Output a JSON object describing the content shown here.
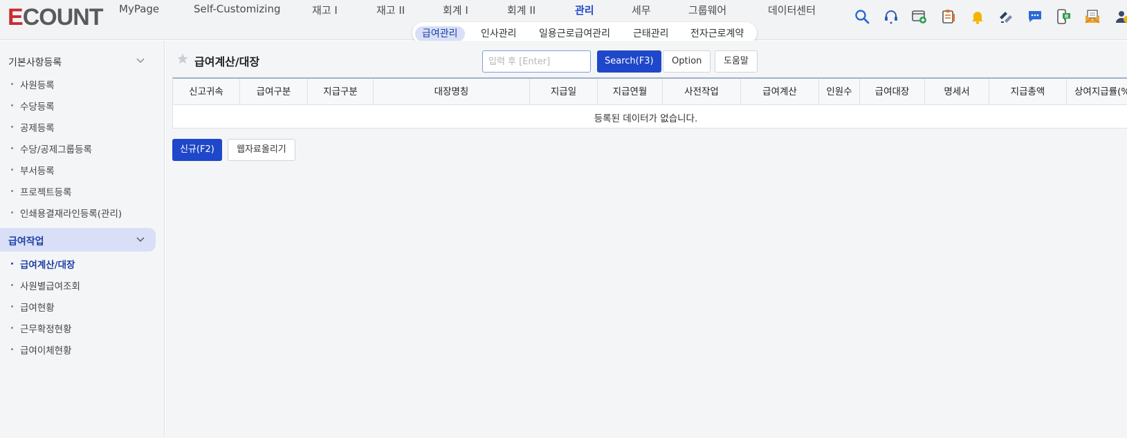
{
  "header": {
    "logo": {
      "first": "E",
      "rest": "COUNT"
    },
    "main_nav": [
      {
        "label": "MyPage",
        "active": false
      },
      {
        "label": "Self-Customizing",
        "active": false
      },
      {
        "label": "재고 I",
        "active": false
      },
      {
        "label": "재고 II",
        "active": false
      },
      {
        "label": "회계 I",
        "active": false
      },
      {
        "label": "회계 II",
        "active": false
      },
      {
        "label": "관리",
        "active": true
      },
      {
        "label": "세무",
        "active": false
      },
      {
        "label": "그룹웨어",
        "active": false
      },
      {
        "label": "데이터센터",
        "active": false
      }
    ],
    "sub_nav": [
      {
        "label": "급여관리",
        "active": true
      },
      {
        "label": "인사관리",
        "active": false
      },
      {
        "label": "일용근로급여관리",
        "active": false
      },
      {
        "label": "근태관리",
        "active": false
      },
      {
        "label": "전자근로계약",
        "active": false
      }
    ],
    "icons": [
      "search-icon",
      "headset-icon",
      "window-add-icon",
      "clipboard-icon",
      "bell-icon",
      "transfer-icon",
      "chat-icon",
      "mobile-message-icon",
      "mail-icon",
      "user-icon"
    ]
  },
  "sidebar": {
    "groups": [
      {
        "label": "기본사항등록",
        "active": false,
        "items": [
          {
            "label": "사원등록",
            "active": false
          },
          {
            "label": "수당등록",
            "active": false
          },
          {
            "label": "공제등록",
            "active": false
          },
          {
            "label": "수당/공제그룹등록",
            "active": false
          },
          {
            "label": "부서등록",
            "active": false
          },
          {
            "label": "프로젝트등록",
            "active": false
          },
          {
            "label": "인쇄용결재라인등록(관리)",
            "active": false
          }
        ]
      },
      {
        "label": "급여작업",
        "active": true,
        "items": [
          {
            "label": "급여계산/대장",
            "active": true
          },
          {
            "label": "사원별급여조회",
            "active": false
          },
          {
            "label": "급여현황",
            "active": false
          },
          {
            "label": "근무확정현황",
            "active": false
          },
          {
            "label": "급여이체현황",
            "active": false
          }
        ]
      }
    ]
  },
  "main": {
    "title": "급여계산/대장",
    "search": {
      "placeholder": "입력 후 [Enter]",
      "value": ""
    },
    "search_button": "Search(F3)",
    "option_button": "Option",
    "help_button": "도움말",
    "table": {
      "columns": [
        "신고귀속",
        "급여구분",
        "지급구분",
        "대장명칭",
        "지급일",
        "지급연월",
        "사전작업",
        "급여계산",
        "인원수",
        "급여대장",
        "명세서",
        "지급총액",
        "상여지급률(%)"
      ],
      "empty_message": "등록된 데이터가 없습니다."
    },
    "new_button": "신규(F2)",
    "upload_button": "웹자료올리기"
  },
  "colors": {
    "accent": "#1f47c9",
    "active_bg": "#d8dff7",
    "logo_red": "#c72c31"
  }
}
